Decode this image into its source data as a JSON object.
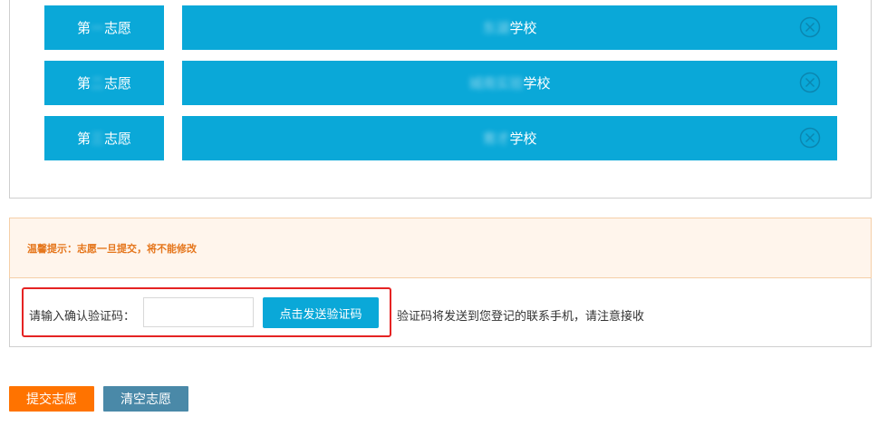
{
  "choices": [
    {
      "label_prefix": "第",
      "label_hidden": "一",
      "label_suffix": "志愿",
      "school_hidden": "东湖",
      "school_suffix": "学校"
    },
    {
      "label_prefix": "第",
      "label_hidden": "二",
      "label_suffix": "志愿",
      "school_hidden": "城南实验",
      "school_suffix": "学校"
    },
    {
      "label_prefix": "第",
      "label_hidden": "三",
      "label_suffix": "志愿",
      "school_hidden": "育才",
      "school_suffix": "学校"
    }
  ],
  "tip": {
    "text": "温馨提示：志愿一旦提交，将不能修改"
  },
  "verify": {
    "label": "请输入确认验证码：",
    "input_value": "",
    "input_placeholder": "",
    "send_button": "点击发送验证码",
    "note": "验证码将发送到您登记的联系手机，请注意接收"
  },
  "actions": {
    "submit": "提交志愿",
    "clear": "清空志愿"
  },
  "colors": {
    "primary_blue": "#0aa8d8",
    "submit_orange": "#ff7300",
    "clear_blue": "#4a89a8",
    "tip_text": "#e5761c",
    "tip_bg": "#fff5ec",
    "highlight_red": "#e52323"
  },
  "icons": {
    "remove": "circle-x-icon"
  }
}
